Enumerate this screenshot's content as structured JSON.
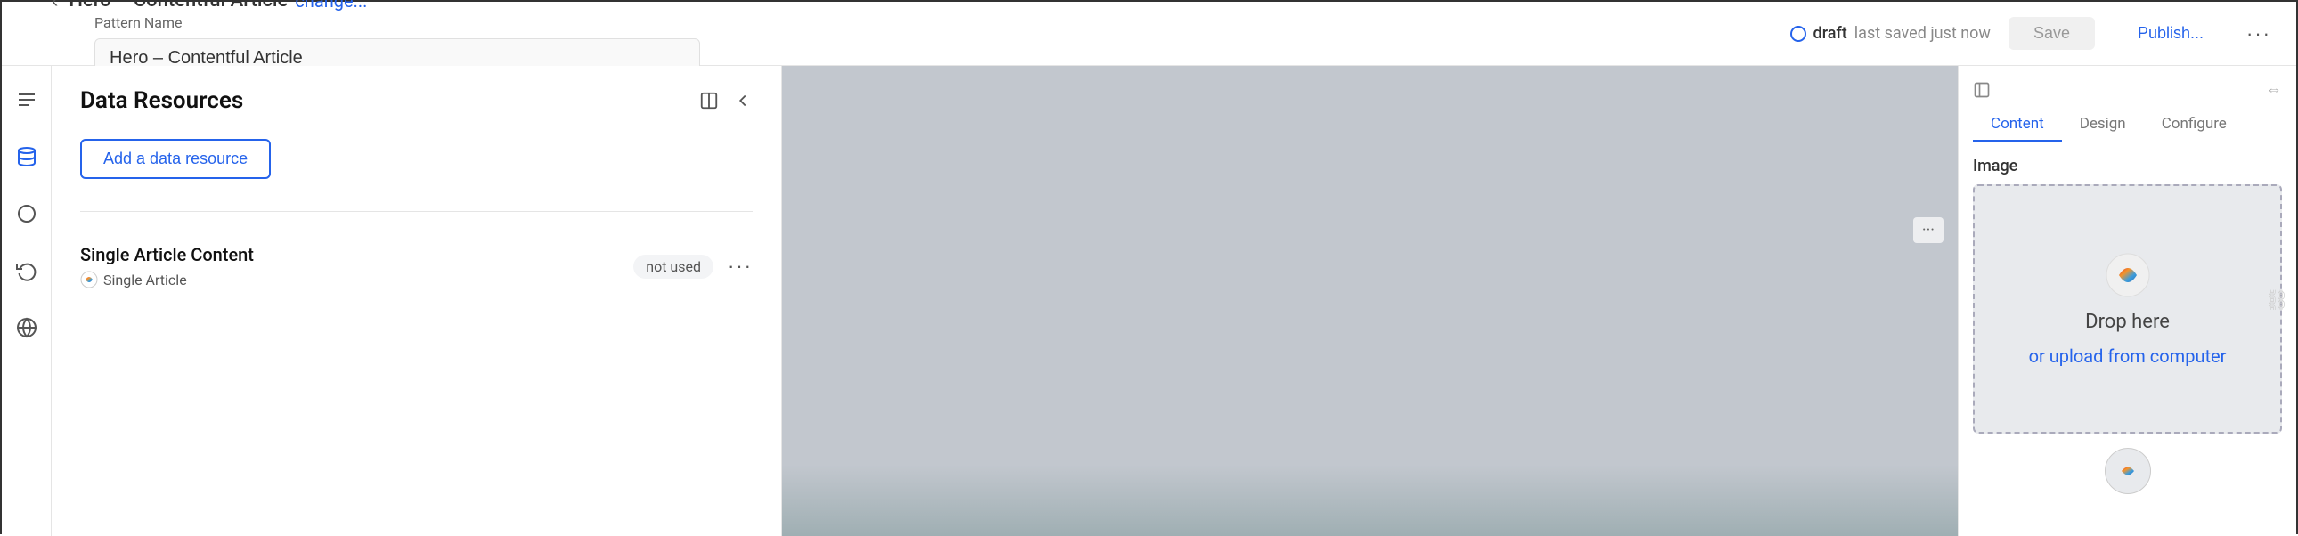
{
  "header": {
    "title": "Hero – Contentful Article",
    "change_link": "change...",
    "pattern_name_label": "Pattern Name",
    "pattern_name_value": "Hero – Contentful Article",
    "draft_label": "draft",
    "last_saved": "last saved just now",
    "save_btn": "Save",
    "publish_btn": "Publish...",
    "more_btn": "···"
  },
  "sidebar": {
    "icons": [
      {
        "name": "layers-icon",
        "symbol": "☰"
      },
      {
        "name": "database-icon",
        "symbol": "🗄"
      },
      {
        "name": "code-icon",
        "symbol": "{…}"
      },
      {
        "name": "history-icon",
        "symbol": "↺"
      },
      {
        "name": "globe-icon",
        "symbol": "🌐"
      }
    ]
  },
  "data_resources_panel": {
    "title": "Data Resources",
    "add_resource_btn": "Add a data resource",
    "resources": [
      {
        "name": "Single Article Content",
        "type": "Single Article",
        "status": "not used"
      }
    ]
  },
  "right_panel": {
    "image_label": "Image",
    "drop_here": "Drop here",
    "upload_link": "or upload from computer",
    "tabs": [
      {
        "label": "Content",
        "active": true
      },
      {
        "label": "Design",
        "active": false
      },
      {
        "label": "Configure",
        "active": false
      }
    ]
  },
  "canvas": {
    "dots_btn": "···"
  }
}
